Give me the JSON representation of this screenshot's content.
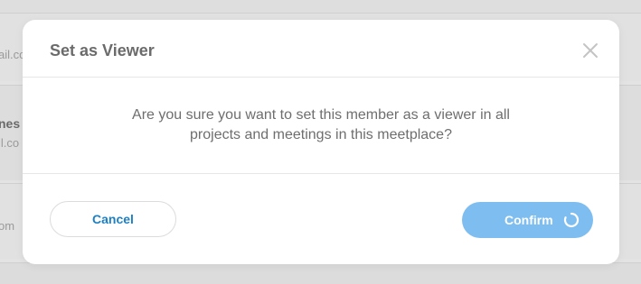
{
  "background": {
    "rows": [
      {
        "text": "ail.co",
        "strong": false
      },
      {
        "text": "nes",
        "strong": true
      },
      {
        "text": "il.co",
        "strong": false
      },
      {
        "text": "om",
        "strong": false
      }
    ]
  },
  "modal": {
    "title": "Set as Viewer",
    "close_icon": "close-icon",
    "message": "Are you sure you want to set this member as a viewer in all projects and meetings in this meetplace?",
    "cancel_label": "Cancel",
    "confirm_label": "Confirm",
    "confirm_state": "loading"
  },
  "colors": {
    "accent": "#1d7fc4",
    "confirm_bg": "#7dbdf0",
    "title": "#6b6b6b",
    "text": "#6e6e6e"
  }
}
